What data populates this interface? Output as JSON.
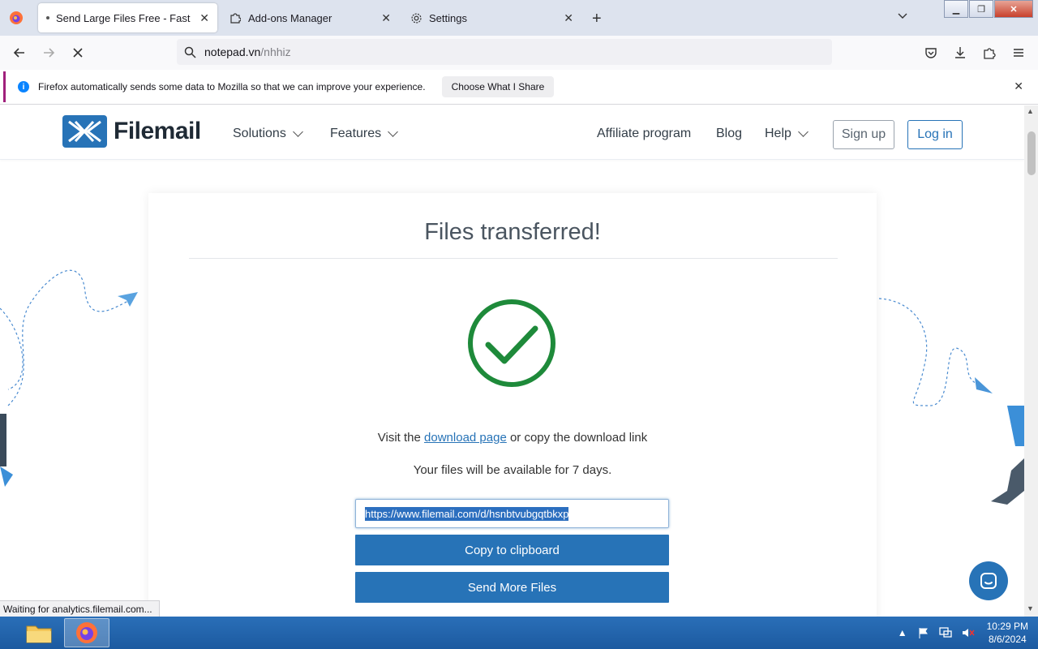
{
  "browser": {
    "tabs": [
      {
        "label": "Send Large Files Free - Fast Secure",
        "active": true
      },
      {
        "label": "Add-ons Manager",
        "active": false
      },
      {
        "label": "Settings",
        "active": false
      }
    ],
    "url_host": "notepad.vn",
    "url_path": "/nhhiz",
    "notification": {
      "text": "Firefox automatically sends some data to Mozilla so that we can improve your experience.",
      "button": "Choose What I Share"
    },
    "status_text": "Waiting for analytics.filemail.com..."
  },
  "site": {
    "logo_text": "Filemail",
    "menu": {
      "solutions": "Solutions",
      "features": "Features",
      "affiliate": "Affiliate program",
      "blog": "Blog",
      "help": "Help"
    },
    "signup": "Sign up",
    "login": "Log in"
  },
  "card": {
    "title": "Files transferred!",
    "visit_prefix": "Visit the ",
    "visit_link": "download page",
    "visit_suffix": " or copy the download link",
    "availability": "Your files will be available for 7 days.",
    "download_link": "https://www.filemail.com/d/hsnbtvubgqtbkxp",
    "copy_button": "Copy to clipboard",
    "send_more_button": "Send More Files"
  },
  "taskbar": {
    "time": "10:29 PM",
    "date": "8/6/2024"
  },
  "colors": {
    "brand_blue": "#2773b7",
    "success_green": "#1e8a3a",
    "notification_accent": "#a0207c"
  }
}
